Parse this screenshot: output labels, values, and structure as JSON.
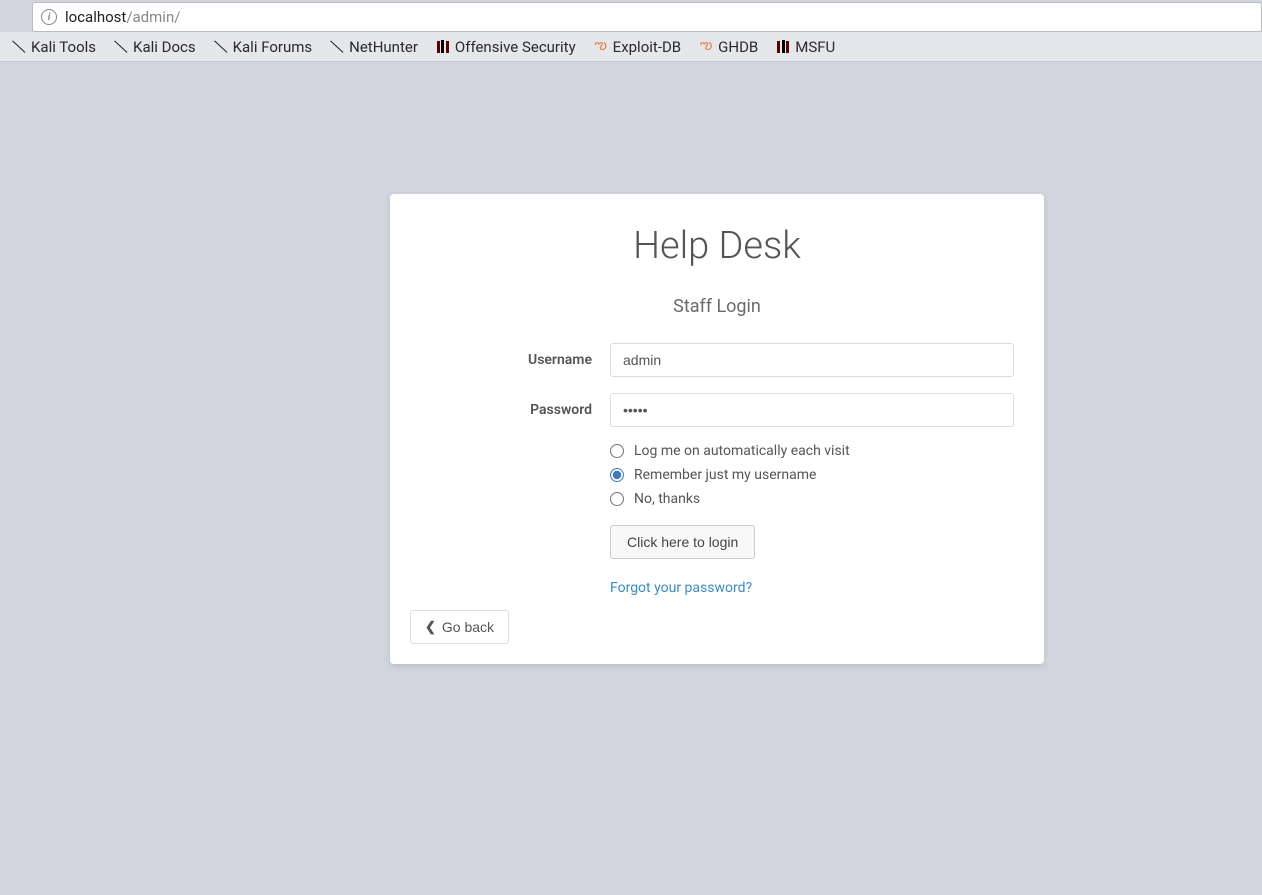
{
  "address_bar": {
    "url_host": "localhost",
    "url_path": "/admin/"
  },
  "bookmarks": [
    {
      "label": "Kali Tools",
      "icon": "dragon"
    },
    {
      "label": "Kali Docs",
      "icon": "dragon"
    },
    {
      "label": "Kali Forums",
      "icon": "dragon"
    },
    {
      "label": "NetHunter",
      "icon": "dragon"
    },
    {
      "label": "Offensive Security",
      "icon": "bars"
    },
    {
      "label": "Exploit-DB",
      "icon": "swirl"
    },
    {
      "label": "GHDB",
      "icon": "swirl"
    },
    {
      "label": "MSFU",
      "icon": "bars"
    }
  ],
  "login": {
    "title": "Help Desk",
    "subtitle": "Staff Login",
    "username_label": "Username",
    "username_value": "admin",
    "password_label": "Password",
    "password_value": "•••••",
    "radio_auto": "Log me on automatically each visit",
    "radio_remember": "Remember just my username",
    "radio_no": "No, thanks",
    "radio_selected": "remember",
    "submit_label": "Click here to login",
    "forgot_label": "Forgot your password?",
    "goback_label": "Go back"
  }
}
